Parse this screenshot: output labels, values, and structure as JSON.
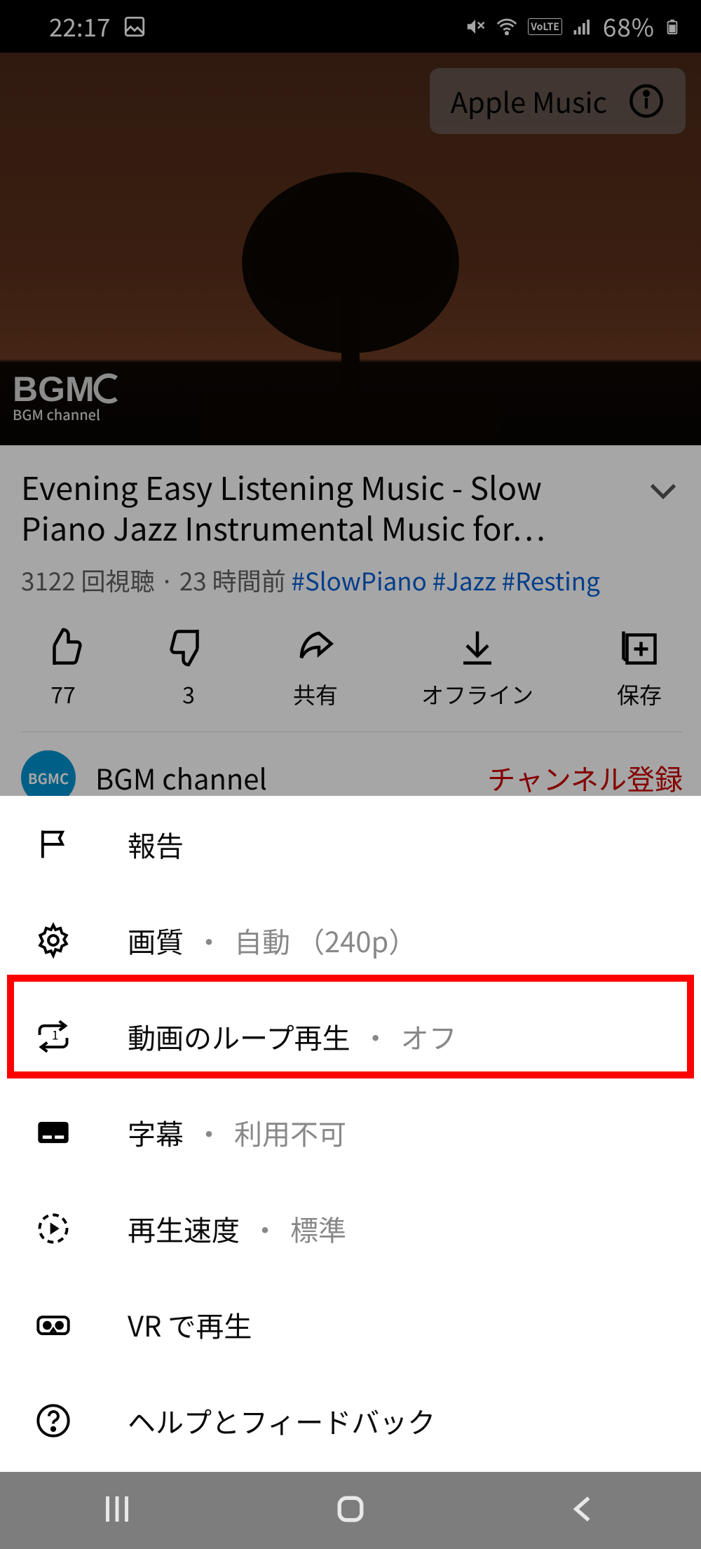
{
  "status": {
    "time": "22:17",
    "battery": "68%"
  },
  "video": {
    "badge": "Apple Music",
    "watermark_top": "BGMC",
    "watermark_bottom": "BGM channel"
  },
  "details": {
    "title": "Evening Easy Listening Music - Slow Piano Jazz Instrumental Music for…",
    "views": "3122 回視聴",
    "sep": " · ",
    "age": "23 時間前",
    "tags": [
      "#SlowPiano",
      "#Jazz",
      "#Resting"
    ]
  },
  "actions": {
    "like": "77",
    "dislike": "3",
    "share": "共有",
    "offline": "オフライン",
    "save": "保存"
  },
  "channel": {
    "avatar_text": "BGMC",
    "name": "BGM channel",
    "subscribe": "チャンネル登録"
  },
  "menu": {
    "report": "報告",
    "quality_label": "画質",
    "quality_value": "自動 （240p）",
    "loop_label": "動画のループ再生",
    "loop_value": "オフ",
    "captions_label": "字幕",
    "captions_value": "利用不可",
    "speed_label": "再生速度",
    "speed_value": "標準",
    "vr": "VR で再生",
    "help": "ヘルプとフィードバック"
  }
}
